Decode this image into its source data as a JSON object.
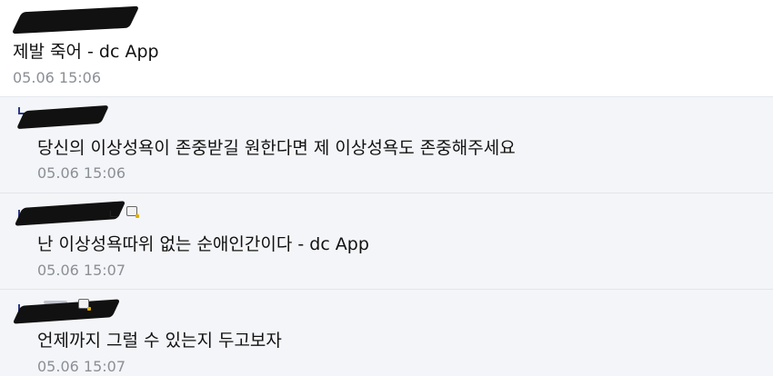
{
  "comments": [
    {
      "type": "comment",
      "text": "제발 죽어 - dc App",
      "time": "05.06 15:06"
    },
    {
      "type": "reply",
      "text": "당신의 이상성욕이 존중받길 원한다면 제 이상성욕도 존중해주세요",
      "time": "05.06 15:06"
    },
    {
      "type": "reply",
      "nick_peek": "ㄴ",
      "text": "난 이상성욕따위 없는 순애인간이다 - dc App",
      "time": "05.06 15:07"
    },
    {
      "type": "reply",
      "text": "언제까지 그럴 수 있는지 두고보자",
      "time": "05.06 15:07"
    }
  ],
  "icons": {
    "reply_marker": "reply-arrow-icon",
    "writer_badge": "gallery-badge-icon"
  },
  "colors": {
    "text": "#111111",
    "timestamp": "#8b8f96",
    "reply_background": "#f4f5f8",
    "reply_marker": "#2e3a8a",
    "divider": "#e2e5ec"
  }
}
